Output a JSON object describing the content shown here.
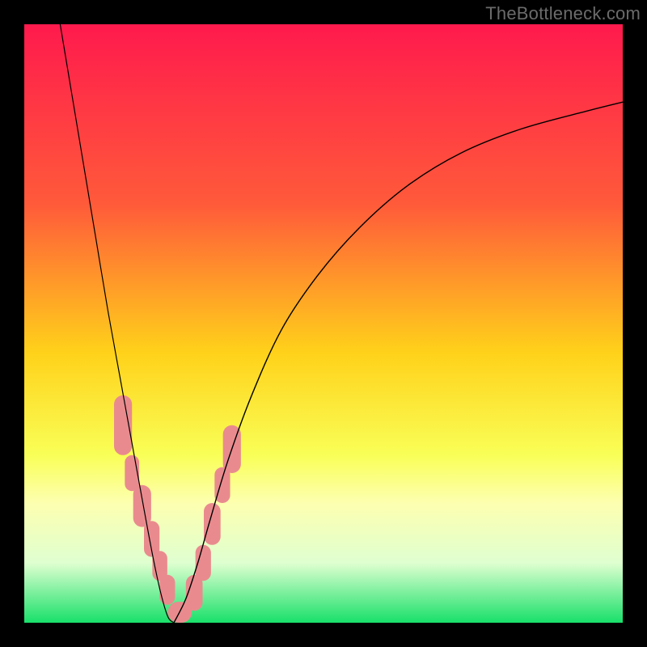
{
  "watermark": "TheBottleneck.com",
  "chart_data": {
    "type": "line",
    "title": "",
    "xlabel": "",
    "ylabel": "",
    "xlim": [
      0,
      100
    ],
    "ylim": [
      0,
      100
    ],
    "grid": false,
    "legend": false,
    "gradient_stops": [
      {
        "offset": 0,
        "color": "#ff1a4d"
      },
      {
        "offset": 0.3,
        "color": "#ff5a3a"
      },
      {
        "offset": 0.55,
        "color": "#ffd21a"
      },
      {
        "offset": 0.72,
        "color": "#f9ff57"
      },
      {
        "offset": 0.8,
        "color": "#fdffb0"
      },
      {
        "offset": 0.9,
        "color": "#dfffd0"
      },
      {
        "offset": 1.0,
        "color": "#18e06a"
      }
    ],
    "series": [
      {
        "name": "curve-left",
        "stroke": "#000000",
        "stroke_width": 1.2,
        "x": [
          6,
          8,
          10,
          12,
          14,
          16,
          18,
          20,
          21.5,
          22.8,
          24,
          25
        ],
        "y": [
          100,
          88,
          76,
          64,
          52,
          41,
          30,
          19,
          11,
          5,
          1,
          0
        ]
      },
      {
        "name": "curve-right",
        "stroke": "#000000",
        "stroke_width": 1.4,
        "x": [
          25,
          27,
          29,
          31,
          34,
          38,
          43,
          49,
          56,
          64,
          73,
          83,
          94,
          100
        ],
        "y": [
          0,
          4,
          10,
          17,
          27,
          38,
          49,
          58,
          66,
          73,
          78.5,
          82.5,
          85.5,
          87
        ]
      }
    ],
    "pink_clusters": {
      "fill": "#e98b8e",
      "stroke": "#e98b8e",
      "rects": [
        {
          "x": 15.0,
          "y": 28,
          "w": 3.0,
          "h": 10
        },
        {
          "x": 16.8,
          "y": 22,
          "w": 2.4,
          "h": 6
        },
        {
          "x": 18.2,
          "y": 16,
          "w": 3.0,
          "h": 7
        },
        {
          "x": 20.0,
          "y": 11,
          "w": 2.6,
          "h": 6
        },
        {
          "x": 21.4,
          "y": 7,
          "w": 2.5,
          "h": 5
        },
        {
          "x": 22.6,
          "y": 3,
          "w": 2.6,
          "h": 5
        },
        {
          "x": 24.0,
          "y": 0,
          "w": 4.0,
          "h": 3.5
        },
        {
          "x": 27.0,
          "y": 2,
          "w": 2.8,
          "h": 6
        },
        {
          "x": 28.6,
          "y": 7,
          "w": 2.6,
          "h": 6
        },
        {
          "x": 30.0,
          "y": 13,
          "w": 2.8,
          "h": 7
        },
        {
          "x": 31.8,
          "y": 20,
          "w": 2.6,
          "h": 6
        },
        {
          "x": 33.2,
          "y": 25,
          "w": 3.0,
          "h": 8
        }
      ]
    }
  }
}
